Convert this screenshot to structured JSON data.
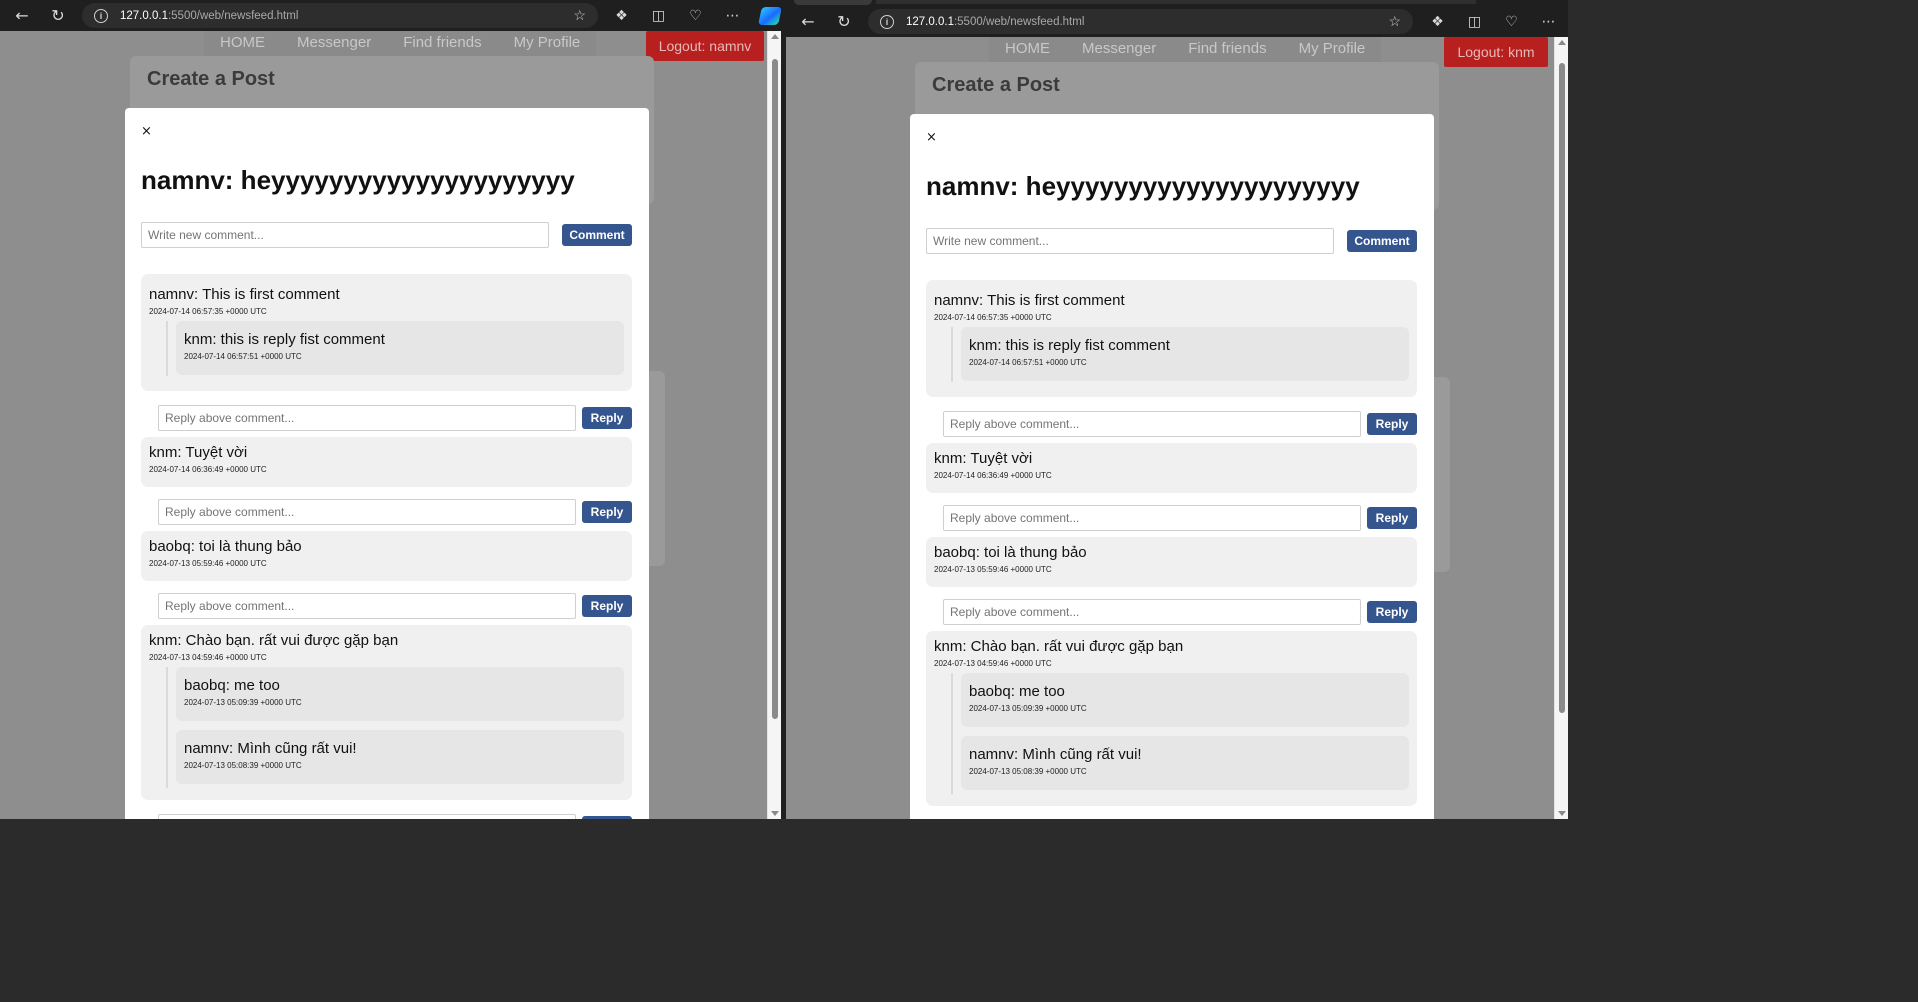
{
  "browser": {
    "url_host": "127.0.0.1",
    "url_path": ":5500/web/newsfeed.html"
  },
  "nav": {
    "items": [
      "HOME",
      "Messenger",
      "Find friends",
      "My Profile"
    ]
  },
  "create_post": {
    "title": "Create a Post"
  },
  "colors": {
    "accent": "#35558f",
    "logout": "#b7201f",
    "comment_bg": "#f0f0f0",
    "reply_bg": "#e6e6e6"
  },
  "windows": [
    {
      "logout_label": "Logout: namnv",
      "scroll_position": 0.12
    },
    {
      "logout_label": "Logout: knm",
      "scroll_position": 0.1
    }
  ],
  "modal": {
    "close_label": "×",
    "post_title": "namnv: heyyyyyyyyyyyyyyyyyyyyy",
    "comment_placeholder": "Write new comment...",
    "comment_button": "Comment",
    "reply_placeholder": "Reply above comment...",
    "reply_button": "Reply",
    "comments": [
      {
        "text": "namnv: This is first comment",
        "date": "2024-07-14 06:57:35 +0000 UTC",
        "replies": [
          {
            "text": "knm: this is reply fist comment",
            "date": "2024-07-14 06:57:51 +0000 UTC"
          }
        ]
      },
      {
        "text": "knm: Tuyệt vời",
        "date": "2024-07-14 06:36:49 +0000 UTC",
        "replies": []
      },
      {
        "text": "baobq: toi là thung bảo",
        "date": "2024-07-13 05:59:46 +0000 UTC",
        "replies": []
      },
      {
        "text": "knm: Chào bạn. rất vui được gặp bạn",
        "date": "2024-07-13 04:59:46 +0000 UTC",
        "replies": [
          {
            "text": "baobq: me too",
            "date": "2024-07-13 05:09:39 +0000 UTC"
          },
          {
            "text": "namnv: Mình cũng rất vui!",
            "date": "2024-07-13 05:08:39 +0000 UTC"
          }
        ]
      }
    ]
  }
}
